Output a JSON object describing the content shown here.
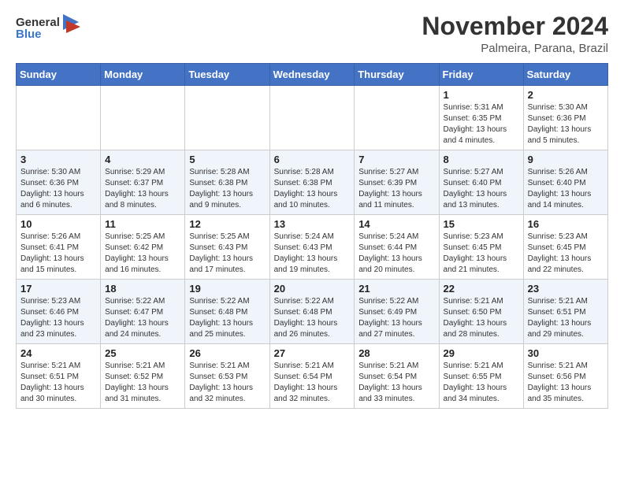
{
  "header": {
    "logo_general": "General",
    "logo_blue": "Blue",
    "month_title": "November 2024",
    "location": "Palmeira, Parana, Brazil"
  },
  "days_of_week": [
    "Sunday",
    "Monday",
    "Tuesday",
    "Wednesday",
    "Thursday",
    "Friday",
    "Saturday"
  ],
  "weeks": [
    {
      "cells": [
        {
          "day": "",
          "info": ""
        },
        {
          "day": "",
          "info": ""
        },
        {
          "day": "",
          "info": ""
        },
        {
          "day": "",
          "info": ""
        },
        {
          "day": "",
          "info": ""
        },
        {
          "day": "1",
          "info": "Sunrise: 5:31 AM\nSunset: 6:35 PM\nDaylight: 13 hours\nand 4 minutes."
        },
        {
          "day": "2",
          "info": "Sunrise: 5:30 AM\nSunset: 6:36 PM\nDaylight: 13 hours\nand 5 minutes."
        }
      ]
    },
    {
      "cells": [
        {
          "day": "3",
          "info": "Sunrise: 5:30 AM\nSunset: 6:36 PM\nDaylight: 13 hours\nand 6 minutes."
        },
        {
          "day": "4",
          "info": "Sunrise: 5:29 AM\nSunset: 6:37 PM\nDaylight: 13 hours\nand 8 minutes."
        },
        {
          "day": "5",
          "info": "Sunrise: 5:28 AM\nSunset: 6:38 PM\nDaylight: 13 hours\nand 9 minutes."
        },
        {
          "day": "6",
          "info": "Sunrise: 5:28 AM\nSunset: 6:38 PM\nDaylight: 13 hours\nand 10 minutes."
        },
        {
          "day": "7",
          "info": "Sunrise: 5:27 AM\nSunset: 6:39 PM\nDaylight: 13 hours\nand 11 minutes."
        },
        {
          "day": "8",
          "info": "Sunrise: 5:27 AM\nSunset: 6:40 PM\nDaylight: 13 hours\nand 13 minutes."
        },
        {
          "day": "9",
          "info": "Sunrise: 5:26 AM\nSunset: 6:40 PM\nDaylight: 13 hours\nand 14 minutes."
        }
      ]
    },
    {
      "cells": [
        {
          "day": "10",
          "info": "Sunrise: 5:26 AM\nSunset: 6:41 PM\nDaylight: 13 hours\nand 15 minutes."
        },
        {
          "day": "11",
          "info": "Sunrise: 5:25 AM\nSunset: 6:42 PM\nDaylight: 13 hours\nand 16 minutes."
        },
        {
          "day": "12",
          "info": "Sunrise: 5:25 AM\nSunset: 6:43 PM\nDaylight: 13 hours\nand 17 minutes."
        },
        {
          "day": "13",
          "info": "Sunrise: 5:24 AM\nSunset: 6:43 PM\nDaylight: 13 hours\nand 19 minutes."
        },
        {
          "day": "14",
          "info": "Sunrise: 5:24 AM\nSunset: 6:44 PM\nDaylight: 13 hours\nand 20 minutes."
        },
        {
          "day": "15",
          "info": "Sunrise: 5:23 AM\nSunset: 6:45 PM\nDaylight: 13 hours\nand 21 minutes."
        },
        {
          "day": "16",
          "info": "Sunrise: 5:23 AM\nSunset: 6:45 PM\nDaylight: 13 hours\nand 22 minutes."
        }
      ]
    },
    {
      "cells": [
        {
          "day": "17",
          "info": "Sunrise: 5:23 AM\nSunset: 6:46 PM\nDaylight: 13 hours\nand 23 minutes."
        },
        {
          "day": "18",
          "info": "Sunrise: 5:22 AM\nSunset: 6:47 PM\nDaylight: 13 hours\nand 24 minutes."
        },
        {
          "day": "19",
          "info": "Sunrise: 5:22 AM\nSunset: 6:48 PM\nDaylight: 13 hours\nand 25 minutes."
        },
        {
          "day": "20",
          "info": "Sunrise: 5:22 AM\nSunset: 6:48 PM\nDaylight: 13 hours\nand 26 minutes."
        },
        {
          "day": "21",
          "info": "Sunrise: 5:22 AM\nSunset: 6:49 PM\nDaylight: 13 hours\nand 27 minutes."
        },
        {
          "day": "22",
          "info": "Sunrise: 5:21 AM\nSunset: 6:50 PM\nDaylight: 13 hours\nand 28 minutes."
        },
        {
          "day": "23",
          "info": "Sunrise: 5:21 AM\nSunset: 6:51 PM\nDaylight: 13 hours\nand 29 minutes."
        }
      ]
    },
    {
      "cells": [
        {
          "day": "24",
          "info": "Sunrise: 5:21 AM\nSunset: 6:51 PM\nDaylight: 13 hours\nand 30 minutes."
        },
        {
          "day": "25",
          "info": "Sunrise: 5:21 AM\nSunset: 6:52 PM\nDaylight: 13 hours\nand 31 minutes."
        },
        {
          "day": "26",
          "info": "Sunrise: 5:21 AM\nSunset: 6:53 PM\nDaylight: 13 hours\nand 32 minutes."
        },
        {
          "day": "27",
          "info": "Sunrise: 5:21 AM\nSunset: 6:54 PM\nDaylight: 13 hours\nand 32 minutes."
        },
        {
          "day": "28",
          "info": "Sunrise: 5:21 AM\nSunset: 6:54 PM\nDaylight: 13 hours\nand 33 minutes."
        },
        {
          "day": "29",
          "info": "Sunrise: 5:21 AM\nSunset: 6:55 PM\nDaylight: 13 hours\nand 34 minutes."
        },
        {
          "day": "30",
          "info": "Sunrise: 5:21 AM\nSunset: 6:56 PM\nDaylight: 13 hours\nand 35 minutes."
        }
      ]
    }
  ]
}
